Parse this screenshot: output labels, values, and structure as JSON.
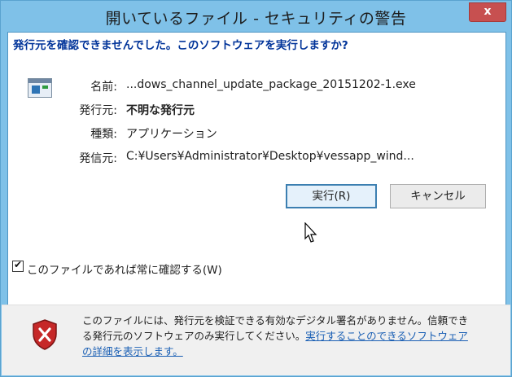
{
  "window": {
    "title": "開いているファイル - セキュリティの警告",
    "close_glyph": "x"
  },
  "heading": "発行元を確認できませんでした。このソフトウェアを実行しますか?",
  "details": {
    "name_label": "名前:",
    "name_value": "...dows_channel_update_package_20151202-1.exe",
    "publisher_label": "発行元:",
    "publisher_value": "不明な発行元",
    "type_label": "種類:",
    "type_value": "アプリケーション",
    "from_label": "発信元:",
    "from_value": "C:¥Users¥Administrator¥Desktop¥vessapp_wind..."
  },
  "buttons": {
    "run": "実行(R)",
    "cancel": "キャンセル"
  },
  "checkbox": {
    "label": "このファイルであれば常に確認する(W)",
    "checked": true
  },
  "warning": {
    "text": "このファイルには、発行元を検証できる有効なデジタル署名がありません。信頼できる発行元のソフトウェアのみ実行してください。",
    "link_text": "実行することのできるソフトウェアの詳細を表示します。"
  },
  "colors": {
    "title_bg": "#7fc1e8",
    "close_bg": "#c75050",
    "heading": "#003399",
    "link": "#1a5fb4"
  }
}
